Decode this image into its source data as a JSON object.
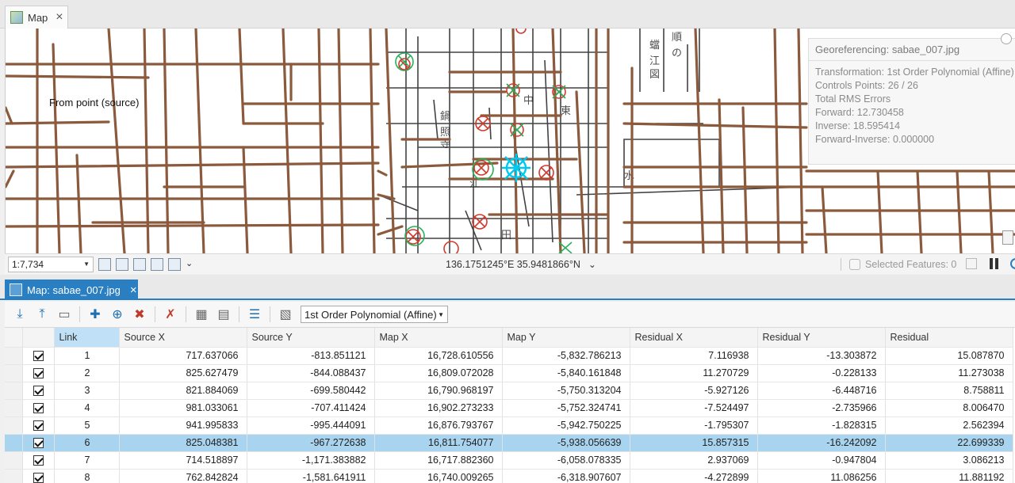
{
  "top_tab": {
    "title": "Map"
  },
  "map": {
    "from_point_label": "From point (source)",
    "georef_panel": {
      "title": "Georeferencing: sabae_007.jpg",
      "transformation": "Transformation: 1st Order Polynomial (Affine)",
      "control_points": "Controls Points: 26 / 26",
      "rms_header": "Total RMS Errors",
      "forward": "Forward: 12.730458",
      "inverse": "Inverse: 18.595414",
      "forward_inverse": "Forward-Inverse: 0.000000"
    }
  },
  "status": {
    "scale": "1:7,734",
    "coordinates": "136.1751245°E 35.9481866°N",
    "selected_features": "Selected Features: 0"
  },
  "lower_tab": {
    "title": "Map: sabae_007.jpg"
  },
  "toolbar": {
    "transformation": "1st Order Polynomial (Affine)"
  },
  "table": {
    "columns": [
      "Link",
      "Source X",
      "Source Y",
      "Map X",
      "Map Y",
      "Residual X",
      "Residual Y",
      "Residual"
    ],
    "rows": [
      {
        "link": "1",
        "source_x": "717.637066",
        "source_y": "-813.851121",
        "map_x": "16,728.610556",
        "map_y": "-5,832.786213",
        "res_x": "7.116938",
        "res_y": "-13.303872",
        "res": "15.087870"
      },
      {
        "link": "2",
        "source_x": "825.627479",
        "source_y": "-844.088437",
        "map_x": "16,809.072028",
        "map_y": "-5,840.161848",
        "res_x": "11.270729",
        "res_y": "-0.228133",
        "res": "11.273038"
      },
      {
        "link": "3",
        "source_x": "821.884069",
        "source_y": "-699.580442",
        "map_x": "16,790.968197",
        "map_y": "-5,750.313204",
        "res_x": "-5.927126",
        "res_y": "-6.448716",
        "res": "8.758811"
      },
      {
        "link": "4",
        "source_x": "981.033061",
        "source_y": "-707.411424",
        "map_x": "16,902.273233",
        "map_y": "-5,752.324741",
        "res_x": "-7.524497",
        "res_y": "-2.735966",
        "res": "8.006470"
      },
      {
        "link": "5",
        "source_x": "941.995833",
        "source_y": "-995.444091",
        "map_x": "16,876.793767",
        "map_y": "-5,942.750225",
        "res_x": "-1.795307",
        "res_y": "-1.828315",
        "res": "2.562394"
      },
      {
        "link": "6",
        "source_x": "825.048381",
        "source_y": "-967.272638",
        "map_x": "16,811.754077",
        "map_y": "-5,938.056639",
        "res_x": "15.857315",
        "res_y": "-16.242092",
        "res": "22.699339"
      },
      {
        "link": "7",
        "source_x": "714.518897",
        "source_y": "-1,171.383882",
        "map_x": "16,717.882360",
        "map_y": "-6,058.078335",
        "res_x": "2.937069",
        "res_y": "-0.947804",
        "res": "3.086213"
      },
      {
        "link": "8",
        "source_x": "762.842824",
        "source_y": "-1,581.641911",
        "map_x": "16,740.009265",
        "map_y": "-6,318.907607",
        "res_x": "-4.272899",
        "res_y": "11.086256",
        "res": "11.881192"
      }
    ]
  }
}
